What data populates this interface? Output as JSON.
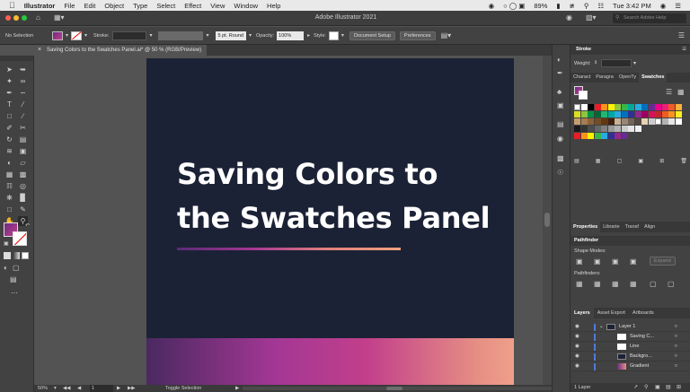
{
  "menubar": {
    "app": "Illustrator",
    "items": [
      "File",
      "Edit",
      "Object",
      "Type",
      "Select",
      "Effect",
      "View",
      "Window",
      "Help"
    ],
    "battery": "89%",
    "clock": "Tue 3:42 PM"
  },
  "titlebar": {
    "title": "Adobe Illustrator 2021",
    "search_placeholder": "Search Adobe Help"
  },
  "control": {
    "selection": "No Selection",
    "stroke_label": "Stroke:",
    "brush": "5 pt. Round",
    "opacity_label": "Opacity:",
    "opacity_value": "100%",
    "style_label": "Style:",
    "doc_setup": "Document Setup",
    "preferences": "Preferences"
  },
  "document": {
    "tab_title": "Saving Colors to  the Swatches Panel.ai* @ 50 % (RGB/Preview)"
  },
  "artwork": {
    "line1": "Saving Colors to",
    "line2": "the Swatches Panel"
  },
  "status": {
    "zoom": "50%",
    "artboard": "1",
    "tool": "Toggle Selection"
  },
  "stroke_panel": {
    "title": "Stroke",
    "weight_label": "Weight:"
  },
  "panel_tabs": {
    "charact": "Charact",
    "paragra": "Paragra",
    "openty": "OpenTy",
    "swatches": "Swatches"
  },
  "props_tabs": {
    "properties": "Properties",
    "library": "Librarie",
    "transform": "Transf",
    "align": "Align"
  },
  "pathfinder": {
    "title": "Pathfinder",
    "shape_modes": "Shape Modes:",
    "expand": "Expand",
    "pathfinders": "Pathfinders:"
  },
  "layers_tabs": {
    "layers": "Layers",
    "asset_export": "Asset Export",
    "artboards": "Artboards"
  },
  "layers": {
    "parent": "Layer 1",
    "children": [
      "Saving C...",
      "Line",
      "Backgro...",
      "Gradient"
    ],
    "count": "1 Layer"
  }
}
